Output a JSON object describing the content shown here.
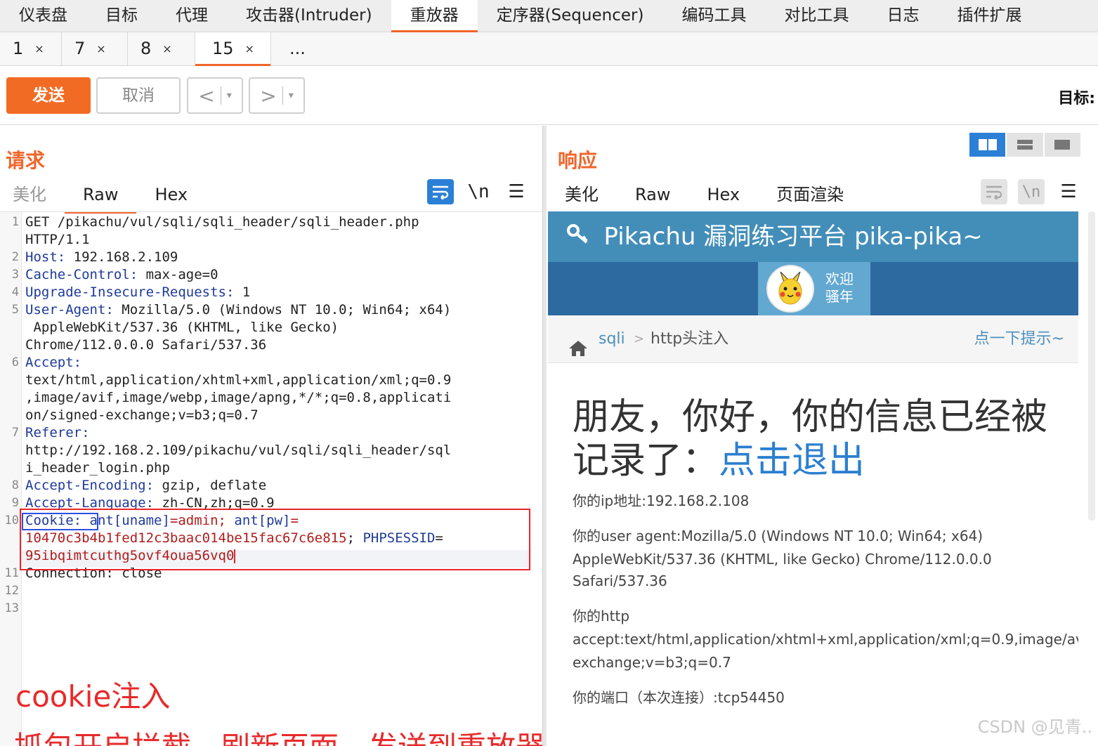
{
  "menu": {
    "items": [
      "仪表盘",
      "目标",
      "代理",
      "攻击器(Intruder)",
      "重放器",
      "定序器(Sequencer)",
      "编码工具",
      "对比工具",
      "日志",
      "插件扩展"
    ],
    "active_index": 4
  },
  "repeater_tabs": [
    {
      "label": "1",
      "close": "×"
    },
    {
      "label": "7",
      "close": "×"
    },
    {
      "label": "8",
      "close": "×"
    },
    {
      "label": "15",
      "close": "×"
    },
    {
      "label": "...",
      "close": ""
    }
  ],
  "toolbar": {
    "send": "发送",
    "cancel": "取消",
    "prev": "<",
    "next": ">",
    "dropdown": "▾",
    "target_label": "目标:"
  },
  "request": {
    "title": "请求",
    "tabs": [
      "美化",
      "Raw",
      "Hex"
    ],
    "active_tab": "Raw",
    "wrap_icon": "≡",
    "newline_icon": "\\n",
    "menu_icon": "☰",
    "line_numbers": [
      "1",
      "2",
      "3",
      "4",
      "5",
      "6",
      "7",
      "8",
      "9",
      "10",
      "11",
      "12",
      "13"
    ],
    "lines": {
      "l1a": "GET /pikachu/vul/sqli/sqli_header/sqli_header.php",
      "l1b": "HTTP/1.1",
      "l2k": "Host: ",
      "l2v": "192.168.2.109",
      "l3k": "Cache-Control: ",
      "l3v": "max-age=0",
      "l4k": "Upgrade-Insecure-Requests: ",
      "l4v": "1",
      "l5k": "User-Agent: ",
      "l5v": "Mozilla/5.0 (Windows NT 10.0; Win64; x64)",
      "l5b": " AppleWebKit/537.36 (KHTML, like Gecko)",
      "l5c": "Chrome/112.0.0.0 Safari/537.36",
      "l6k": "Accept:",
      "l6a": "text/html,application/xhtml+xml,application/xml;q=0.9",
      "l6b": ",image/avif,image/webp,image/apng,*/*;q=0.8,applicati",
      "l6c": "on/signed-exchange;v=b3;q=0.7",
      "l7k": "Referer:",
      "l7a": "http://192.168.2.109/pikachu/vul/sqli/sqli_header/sql",
      "l7b": "i_header_login.php",
      "l8k": "Accept-Encoding: ",
      "l8v": "gzip, deflate",
      "l9k": "Accept-Language: ",
      "l9v": "zh-CN,zh;q=0.9",
      "l10k": "Cookie: ",
      "l10a": "ant[uname]",
      "l10b": "=admin; ",
      "l10c": "ant[pw]",
      "l10d": "=",
      "l10e": "10470c3b4b1fed12c3baac014be15fac67c6e815",
      "l10f": "; ",
      "l10g": "PHPSESSID",
      "l10h": "=",
      "l10i": "95ibqimtcuthg5ovf4oua56vq0",
      "l11": "Connection: close"
    },
    "annotation_1": "cookie注入",
    "annotation_2": "抓包开启拦截，刷新页面，发送到重放器"
  },
  "response": {
    "title": "响应",
    "tabs": [
      "美化",
      "Raw",
      "Hex",
      "页面渲染"
    ],
    "active_tab": "页面渲染",
    "wrap_icon": "≡",
    "newline_icon": "\\n",
    "menu_icon": "☰",
    "render": {
      "site_title": "Pikachu 漏洞练习平台 pika-pika~",
      "welcome_line1": "欢迎",
      "welcome_line2": "骚年",
      "breadcrumb_home": "sqli",
      "breadcrumb_sep": ">",
      "breadcrumb_current": "http头注入",
      "hint": "点一下提示~",
      "big_text": "朋友，你好，你的信息已经被记录了：",
      "logout_link": "点击退出",
      "ip_line": "你的ip地址:192.168.2.108",
      "ua_line1": "你的user agent:Mozilla/5.0 (Windows NT 10.0; Win64; x64)",
      "ua_line2": "AppleWebKit/537.36 (KHTML, like Gecko) Chrome/112.0.0.0",
      "ua_line3": "Safari/537.36",
      "accept_label": "你的http",
      "accept_line1": "accept:text/html,application/xhtml+xml,application/xml;q=0.9,image/av",
      "accept_line2": "exchange;v=b3;q=0.7",
      "port_line": "你的端口（本次连接）:tcp54450"
    }
  },
  "watermark": "CSDN @见青..",
  "colors": {
    "accent": "#f0652b",
    "send_button": "#f26b24",
    "highlight_red": "#e8262c",
    "highlight_blue": "#2d4fe0",
    "pikachu_header": "#438eb9",
    "pikachu_nav": "#2c6aa0"
  }
}
